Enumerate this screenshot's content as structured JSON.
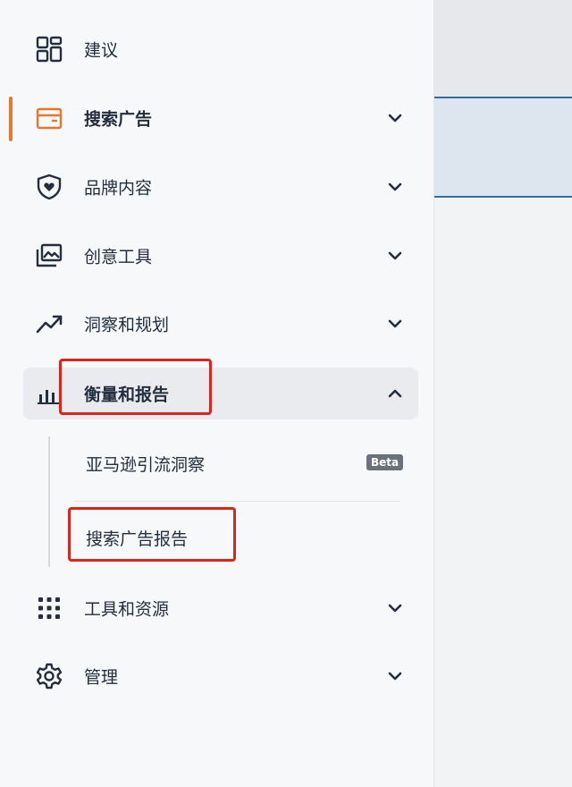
{
  "nav": {
    "items": [
      {
        "label": "建议",
        "icon": "grid-icon"
      },
      {
        "label": "搜索广告",
        "icon": "wallet-icon",
        "active": true
      },
      {
        "label": "品牌内容",
        "icon": "shield-heart-icon"
      },
      {
        "label": "创意工具",
        "icon": "images-icon"
      },
      {
        "label": "洞察和规划",
        "icon": "trend-up-icon"
      },
      {
        "label": "衡量和报告",
        "icon": "bar-chart-icon",
        "expanded": true
      },
      {
        "label": "工具和资源",
        "icon": "apps-grid-icon"
      },
      {
        "label": "管理",
        "icon": "gear-icon"
      }
    ],
    "subitems": [
      {
        "label": "亚马逊引流洞察",
        "badge": "Beta"
      },
      {
        "label": "搜索广告报告"
      }
    ]
  },
  "colors": {
    "accent": "#e8772e",
    "highlight_outline": "#d9261c",
    "text": "#232f3e"
  }
}
